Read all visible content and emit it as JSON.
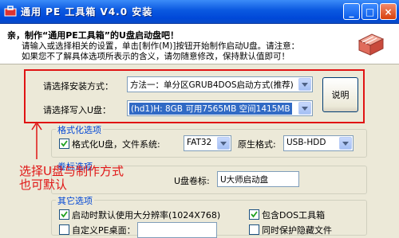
{
  "window": {
    "title": "通用 PE 工具箱 V4.0 安装",
    "buttons": {
      "minimize": "_",
      "maximize": "□",
      "close": "×"
    }
  },
  "header": {
    "line1": "亲，制作“通用PE工具箱”的U盘启动盘吧！",
    "line2": "请输入或选择相关的设置，单击[制作(M)]按钮开始制作启动U盘。请注意：",
    "line3": "如果您不了解具体选项所表示的含义，请勿随意修改，保持默认值即可！"
  },
  "install": {
    "method_label": "请选择安装方式：",
    "method_value": "方法一：单分区GRUB4DOS启动方式(推荐)",
    "disk_label": "请选择写入U盘：",
    "disk_value": "(hd1)H: 8GB 可用7565MB 空间1415MB",
    "explain_button": "说明"
  },
  "format": {
    "group_title": "格式化选项",
    "format_check_label": "格式化U盘，文件系统:",
    "filesystem_value": "FAT32",
    "original_format_label": "原生格式:",
    "original_format_value": "USB-HDD"
  },
  "volume": {
    "group_title": "卷标选项",
    "label": "U盘卷标:",
    "value": "U大师启动盘"
  },
  "other": {
    "group_title": "其它选项",
    "resolution_label": "启动时默认使用大分辨率(1024X768)",
    "include_dos_label": "包含DOS工具箱",
    "custom_label": "自定义PE桌面：",
    "protect_label": "同时保护隐藏文件"
  },
  "annotation": {
    "line1": "选择U盘与制作方式",
    "line2": "也可默认"
  },
  "colors": {
    "titlebar": "#0a58e0",
    "annotation": "#e01414",
    "group_title": "#0046d5",
    "selection": "#316ac5"
  },
  "icons": [
    "app-icon",
    "toolbox-icon",
    "check-icon",
    "dropdown-arrow-icon"
  ]
}
